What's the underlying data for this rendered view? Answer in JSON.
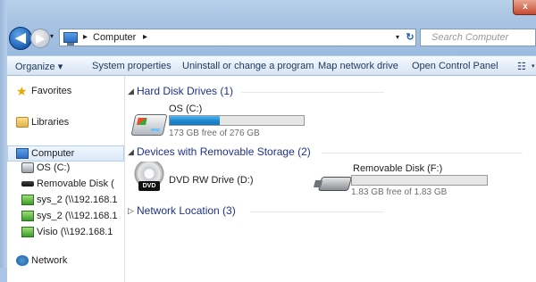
{
  "window": {
    "close_label": "x"
  },
  "nav": {
    "back_glyph": "◀",
    "forward_glyph": "▶",
    "history_glyph": "▾",
    "address_separator": "▸",
    "address_location": "Computer",
    "address_dropdown_glyph": "▾",
    "refresh_glyph": "↻",
    "search_placeholder": "Search Computer"
  },
  "toolbar": {
    "organize": "Organize ▾",
    "system_properties": "System properties",
    "uninstall": "Uninstall or change a program",
    "map_drive": "Map network drive",
    "control_panel": "Open Control Panel",
    "view_glyph": "☷",
    "view_dropdown_glyph": "▾"
  },
  "sidebar": {
    "favorites": "Favorites",
    "libraries": "Libraries",
    "computer": "Computer",
    "os_drive": "OS (C:)",
    "removable": "Removable Disk (",
    "net1": "sys_2 (\\\\192.168.1",
    "net2": "sys_2 (\\\\192.168.1",
    "net3": "Visio (\\\\192.168.1",
    "network": "Network"
  },
  "content": {
    "groups": {
      "hard_disk": "Hard Disk Drives (1)",
      "removable": "Devices with Removable Storage (2)",
      "network": "Network Location (3)"
    },
    "expanded_glyph": "◢",
    "collapsed_glyph": "▷",
    "os_drive": {
      "name": "OS (C:)",
      "free": "173 GB free of 276 GB",
      "used_fraction": 0.373
    },
    "dvd": {
      "name": "DVD RW Drive (D:)",
      "badge": "DVD"
    },
    "usb": {
      "name": "Removable Disk (F:)",
      "free": "1.83 GB free of 1.83 GB",
      "used_fraction": 0.0
    }
  },
  "colors": {
    "group_header": "#1e3287",
    "bar_fill": "#1f8ad1",
    "frame": "#a7c3e3"
  }
}
